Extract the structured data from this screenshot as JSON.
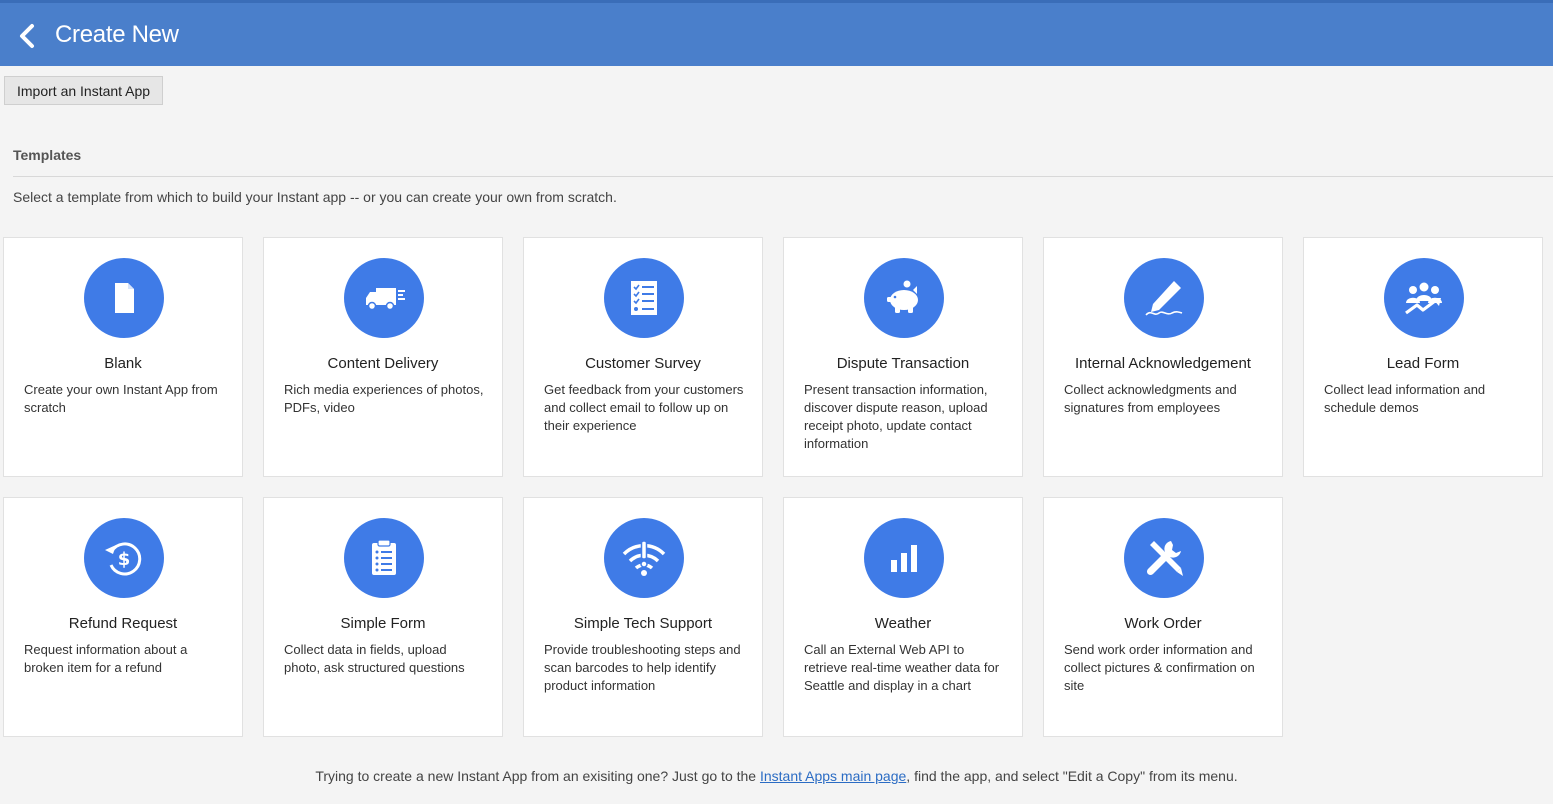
{
  "header": {
    "title": "Create New",
    "back_icon": "chevron-left-icon"
  },
  "import_button": "Import an Instant App",
  "templates": {
    "heading": "Templates",
    "description": "Select a template from which to build your Instant app -- or you can create your own from scratch.",
    "items": [
      {
        "title": "Blank",
        "desc": "Create your own Instant App from scratch",
        "icon": "document-icon"
      },
      {
        "title": "Content Delivery",
        "desc": "Rich media experiences of photos, PDFs, video",
        "icon": "delivery-truck-icon"
      },
      {
        "title": "Customer Survey",
        "desc": "Get feedback from your customers and collect email to follow up on their experience",
        "icon": "checklist-icon"
      },
      {
        "title": "Dispute Transaction",
        "desc": "Present transaction information, discover dispute reason, upload receipt photo, update contact information",
        "icon": "piggy-bank-icon"
      },
      {
        "title": "Internal Acknowledgement",
        "desc": "Collect acknowledgments and signatures from employees",
        "icon": "pen-signature-icon"
      },
      {
        "title": "Lead Form",
        "desc": "Collect lead information and schedule demos",
        "icon": "group-growth-icon"
      },
      {
        "title": "Refund Request",
        "desc": "Request information about a broken item for a refund",
        "icon": "refund-dollar-icon"
      },
      {
        "title": "Simple Form",
        "desc": "Collect data in fields, upload photo, ask structured questions",
        "icon": "clipboard-icon"
      },
      {
        "title": "Simple Tech Support",
        "desc": "Provide troubleshooting steps and scan barcodes to help identify product information",
        "icon": "wifi-alert-icon"
      },
      {
        "title": "Weather",
        "desc": "Call an External Web API to retrieve real-time weather data for Seattle and display in a chart",
        "icon": "bar-chart-icon"
      },
      {
        "title": "Work Order",
        "desc": "Send work order information and collect pictures & confirmation on site",
        "icon": "tools-icon"
      }
    ]
  },
  "footer": {
    "before": "Trying to create a new Instant App from an exisiting one? Just go to the ",
    "link": "Instant Apps main page",
    "after": ", find the app, and select \"Edit a Copy\" from its menu."
  },
  "colors": {
    "header_bg": "#4a7fcb",
    "icon_bg": "#3f7be7",
    "link": "#2b6cc4"
  }
}
